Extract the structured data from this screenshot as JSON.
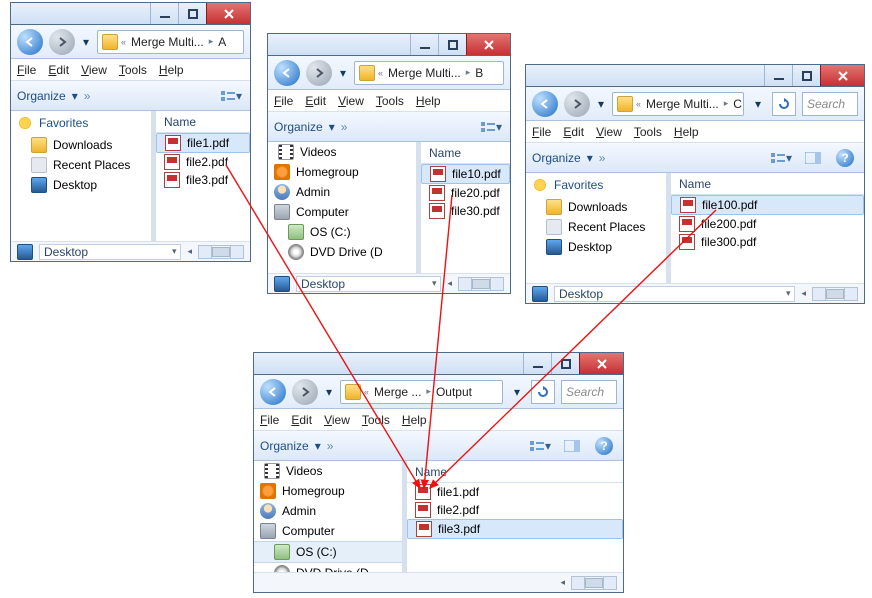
{
  "menu": {
    "file": "File",
    "edit": "Edit",
    "view": "View",
    "tools": "Tools",
    "help": "Help"
  },
  "toolbar": {
    "organize": "Organize",
    "chevrons": "»"
  },
  "columns": {
    "name": "Name"
  },
  "searchHint": "Search",
  "nav": {
    "favorites": "Favorites",
    "downloads": "Downloads",
    "recent": "Recent Places",
    "desktop": "Desktop",
    "videos": "Videos",
    "homegroup": "Homegroup",
    "admin": "Admin",
    "computer": "Computer",
    "drive": "OS (C:)",
    "dvd": "DVD Drive (D"
  },
  "windows": {
    "A": {
      "crumb1": "Merge Multi...",
      "crumb2": "A",
      "combo": "Desktop",
      "files": {
        "f0": "file1.pdf",
        "f1": "file2.pdf",
        "f2": "file3.pdf"
      }
    },
    "B": {
      "crumb1": "Merge Multi...",
      "crumb2": "B",
      "combo": "Desktop",
      "files": {
        "f0": "file10.pdf",
        "f1": "file20.pdf",
        "f2": "file30.pdf"
      }
    },
    "C": {
      "crumb1": "Merge Multi...",
      "crumb2": "C",
      "combo": "Desktop",
      "files": {
        "f0": "file100.pdf",
        "f1": "file200.pdf",
        "f2": "file300.pdf"
      }
    },
    "O": {
      "crumb1": "Merge ...",
      "crumb2": "Output",
      "files": {
        "f0": "file1.pdf",
        "f1": "file2.pdf",
        "f2": "file3.pdf"
      }
    }
  }
}
